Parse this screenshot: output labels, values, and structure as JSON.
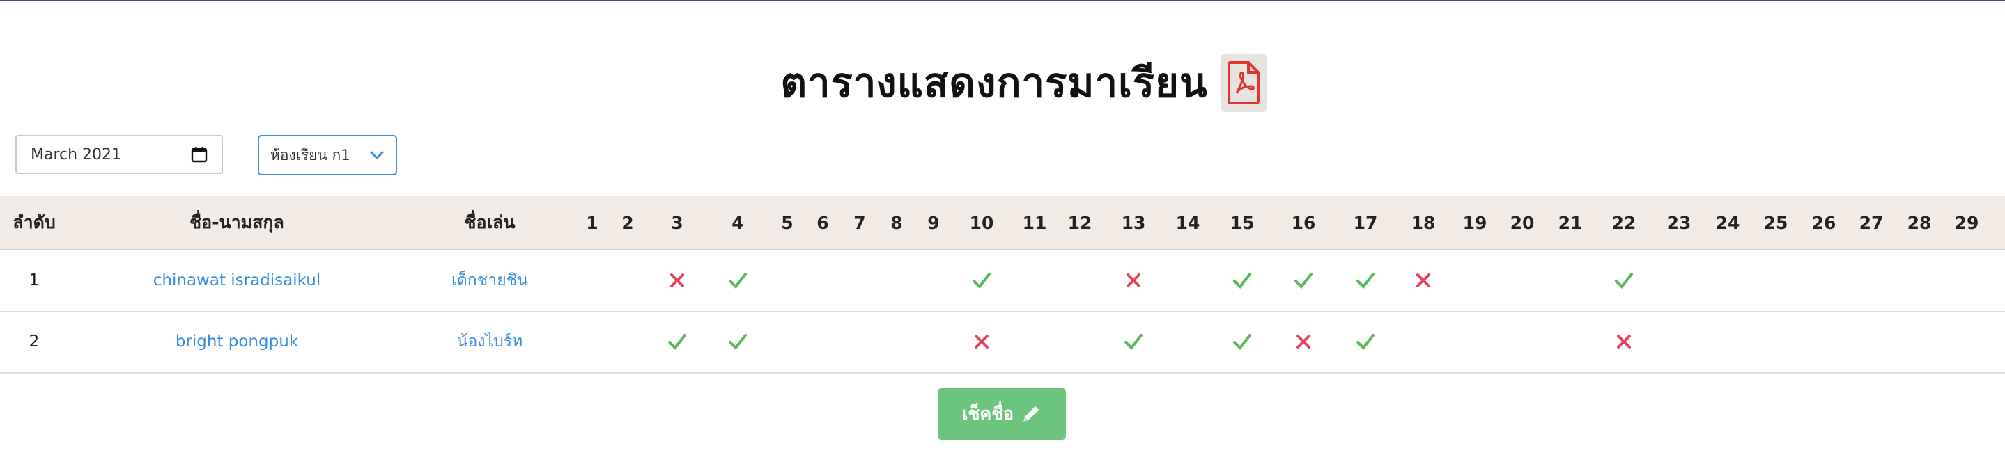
{
  "header": {
    "title": "ตารางแสดงการมาเรียน",
    "pdf_icon": "file-pdf-icon"
  },
  "filters": {
    "month_value": "March 2021",
    "calendar_icon": "calendar-icon",
    "room_value": "ห้องเรียน ก1",
    "room_icon": "chevron-down-icon"
  },
  "table": {
    "headers": {
      "no": "ลำดับ",
      "name": "ชื่อ-นามสกุล",
      "nick": "ชื่อเล่น"
    },
    "days": [
      "1",
      "2",
      "3",
      "4",
      "5",
      "6",
      "7",
      "8",
      "9",
      "10",
      "11",
      "12",
      "13",
      "14",
      "15",
      "16",
      "17",
      "18",
      "19",
      "20",
      "21",
      "22",
      "23",
      "24",
      "25",
      "26",
      "27",
      "28",
      "29"
    ],
    "rows": [
      {
        "no": "1",
        "name": "chinawat isradisaikul",
        "nick": "เด็กชายชิน",
        "marks": {
          "3": "absent",
          "4": "present",
          "10": "present",
          "13": "absent",
          "15": "present",
          "16": "present",
          "17": "present",
          "18": "absent",
          "22": "present"
        }
      },
      {
        "no": "2",
        "name": "bright pongpuk",
        "nick": "น้องไบร์ท",
        "marks": {
          "3": "present",
          "4": "present",
          "10": "absent",
          "13": "present",
          "15": "present",
          "16": "absent",
          "17": "present",
          "22": "absent"
        }
      }
    ]
  },
  "actions": {
    "submit_label": "เช็คชื่อ",
    "submit_icon": "pencil-icon"
  },
  "colors": {
    "present": "#5cb85c",
    "absent": "#e0485a",
    "link": "#3a8fdc",
    "header_bg": "#f2ebe5",
    "button": "#6cc57c"
  }
}
